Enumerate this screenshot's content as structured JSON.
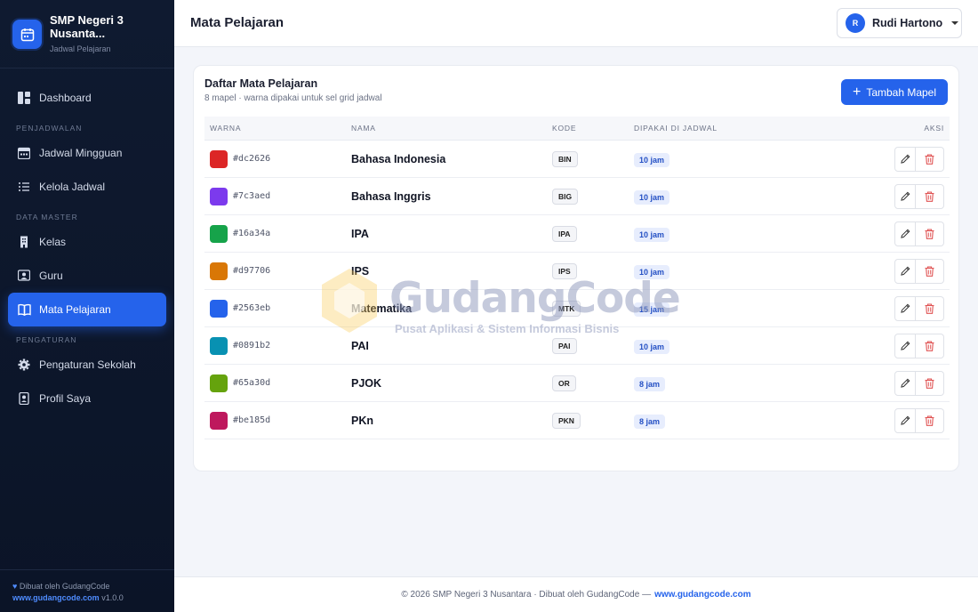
{
  "sidebar": {
    "brand_name": "SMP Negeri 3 Nusanta...",
    "brand_sub": "Jadwal Pelajaran",
    "items": {
      "dashboard": "Dashboard",
      "section_penjadwalan": "PENJADWALAN",
      "jadwal_mingguan": "Jadwal Mingguan",
      "kelola_jadwal": "Kelola Jadwal",
      "section_data_master": "DATA MASTER",
      "kelas": "Kelas",
      "guru": "Guru",
      "mata_pelajaran": "Mata Pelajaran",
      "section_pengaturan": "PENGATURAN",
      "pengaturan_sekolah": "Pengaturan Sekolah",
      "profil_saya": "Profil Saya"
    },
    "footer_line1": "Dibuat oleh GudangCode",
    "footer_link": "www.gudangcode.com",
    "footer_version": "v1.0.0"
  },
  "header": {
    "title": "Mata Pelajaran",
    "user_initial": "R",
    "user_name": "Rudi Hartono"
  },
  "card": {
    "title": "Daftar Mata Pelajaran",
    "subtitle": "8 mapel · warna dipakai untuk sel grid jadwal",
    "add_label": "Tambah Mapel"
  },
  "table": {
    "headers": {
      "warna": "WARNA",
      "nama": "NAMA",
      "kode": "KODE",
      "dipakai": "DIPAKAI DI JADWAL",
      "aksi": "AKSI"
    },
    "rows": [
      {
        "color": "#dc2626",
        "nama": "Bahasa Indonesia",
        "kode": "BIN",
        "jam": "10 jam"
      },
      {
        "color": "#7c3aed",
        "nama": "Bahasa Inggris",
        "kode": "BIG",
        "jam": "10 jam"
      },
      {
        "color": "#16a34a",
        "nama": "IPA",
        "kode": "IPA",
        "jam": "10 jam"
      },
      {
        "color": "#d97706",
        "nama": "IPS",
        "kode": "IPS",
        "jam": "10 jam"
      },
      {
        "color": "#2563eb",
        "nama": "Matematika",
        "kode": "MTK",
        "jam": "15 jam"
      },
      {
        "color": "#0891b2",
        "nama": "PAI",
        "kode": "PAI",
        "jam": "10 jam"
      },
      {
        "color": "#65a30d",
        "nama": "PJOK",
        "kode": "OR",
        "jam": "8 jam"
      },
      {
        "color": "#be185d",
        "nama": "PKn",
        "kode": "PKN",
        "jam": "8 jam"
      }
    ]
  },
  "watermark": {
    "title": "GudangCode",
    "subtitle": "Pusat Aplikasi & Sistem Informasi Bisnis"
  },
  "footer": {
    "text": "© 2026 SMP Negeri 3 Nusantara · Dibuat oleh GudangCode —",
    "link": "www.gudangcode.com"
  },
  "colors": {
    "accent": "#2563eb",
    "sidebar_bg": "#0f1a30"
  }
}
